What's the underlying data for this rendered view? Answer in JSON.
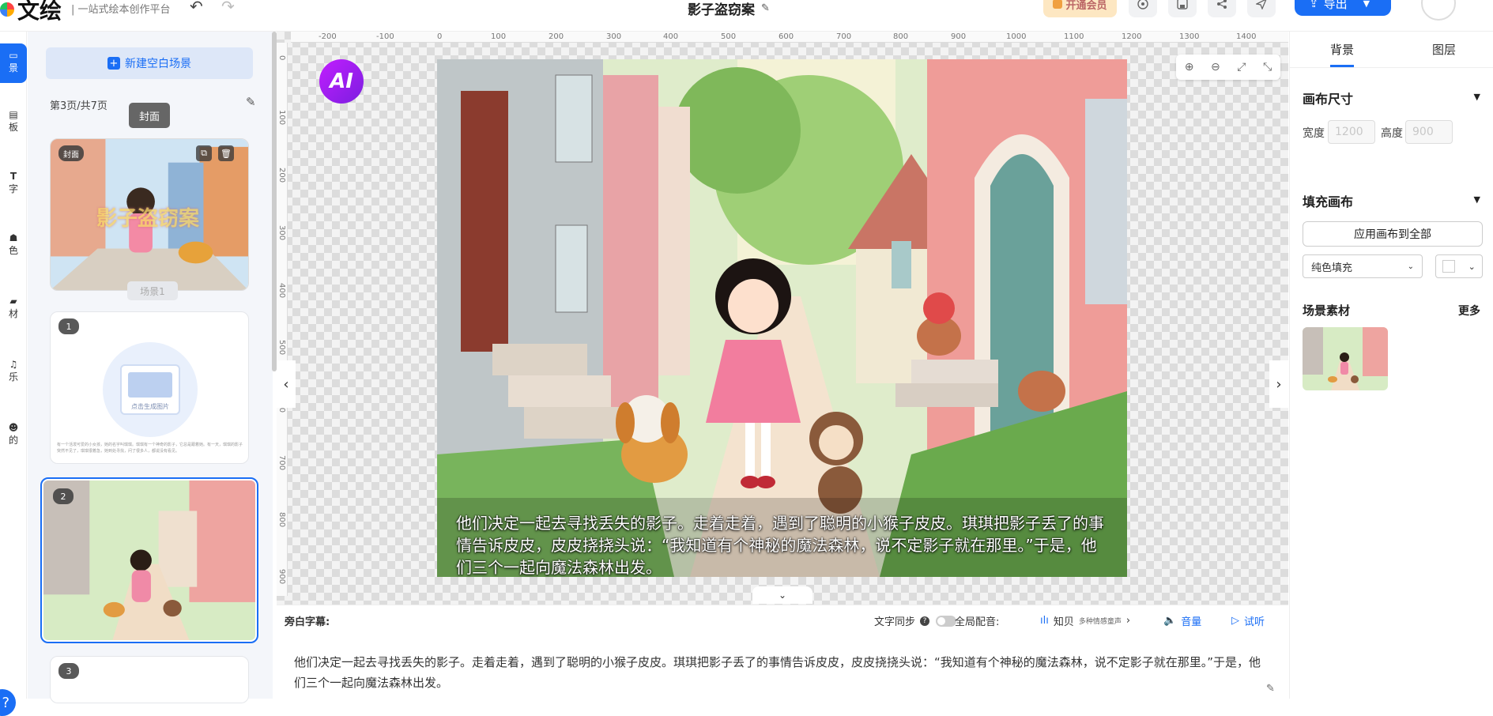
{
  "header": {
    "logo_text": "文绘",
    "logo_subtitle": "| 一站式绘本创作平台",
    "doc_title": "影子盗窃案",
    "vip_label": "开通会员",
    "export_label": "导出"
  },
  "rail": {
    "items": [
      {
        "label": "景"
      },
      {
        "label": "板"
      },
      {
        "label": "字"
      },
      {
        "label": "色"
      },
      {
        "label": "材"
      },
      {
        "label": "乐"
      },
      {
        "label": "的"
      }
    ],
    "help": "?"
  },
  "scenes": {
    "new_button": "新建空白场景",
    "page_indicator": "第3页/共7页",
    "tooltip": "封面",
    "tooltip_scene": "场景1",
    "cards": [
      {
        "badge": "封面",
        "title_overlay": "影子盗窃案"
      },
      {
        "badge": "1",
        "placeholder": "点击生成图片",
        "text": "有一个活泼可爱的小女孩，她的名字叫琪琪。琪琪有一个神奇的影子，它总是跟着她。有一天，琪琪的影子突然不见了，琪琪很着急，她到处寻找，问了很多人，都说没有看见。"
      },
      {
        "badge": "2"
      },
      {
        "badge": "3"
      }
    ]
  },
  "canvas": {
    "ai_badge": "AI",
    "ruler_x": [
      "-200",
      "-100",
      "0",
      "100",
      "200",
      "300",
      "400",
      "500",
      "600",
      "700",
      "800",
      "900",
      "1000",
      "1100",
      "1200",
      "1300",
      "1400"
    ],
    "ruler_y": [
      "0",
      "100",
      "200",
      "300",
      "400",
      "500",
      "600",
      "700",
      "800",
      "900"
    ],
    "caption": "他们决定一起去寻找丢失的影子。走着走着，遇到了聪明的小猴子皮皮。琪琪把影子丢了的事情告诉皮皮，皮皮挠挠头说：“我知道有个神秘的魔法森林，说不定影子就在那里。”于是，他们三个一起向魔法森林出发。"
  },
  "narration": {
    "label": "旁白字幕:",
    "sync_label": "文字同步",
    "voice_label": "全局配音:",
    "voice_name": "知贝",
    "voice_desc": "多种情感童声",
    "volume_label": "音量",
    "preview_label": "试听",
    "text": "他们决定一起去寻找丢失的影子。走着走着，遇到了聪明的小猴子皮皮。琪琪把影子丢了的事情告诉皮皮，皮皮挠挠头说：“我知道有个神秘的魔法森林，说不定影子就在那里。”于是，他们三个一起向魔法森林出发。"
  },
  "right_panel": {
    "tabs": [
      "背景",
      "图层"
    ],
    "canvas_size_title": "画布尺寸",
    "width_label": "宽度",
    "width_value": "1200",
    "height_label": "高度",
    "height_value": "900",
    "fill_title": "填充画布",
    "apply_all": "应用画布到全部",
    "fill_type": "纯色填充",
    "material_title": "场景素材",
    "more": "更多"
  },
  "colors": {
    "accent": "#1a6ef5",
    "panel_bg": "#f4f6fa",
    "ai_badge": "#a020f0"
  }
}
